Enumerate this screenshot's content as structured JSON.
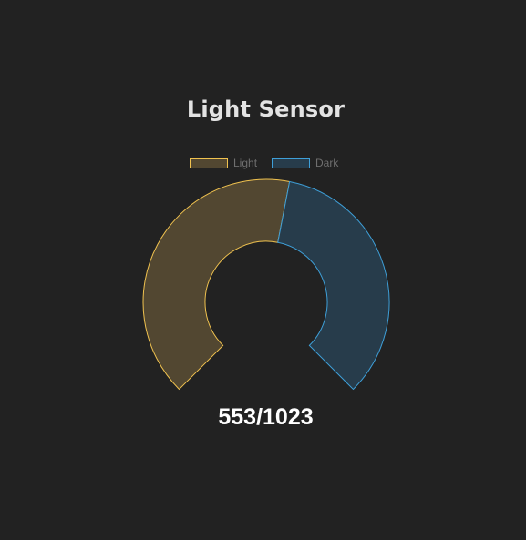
{
  "chart_data": {
    "type": "doughnut-gauge",
    "title": "Light Sensor",
    "series": [
      {
        "name": "Light",
        "value": 553,
        "fill": "#524731",
        "stroke": "#f0c24f"
      },
      {
        "name": "Dark",
        "value": 470,
        "fill": "#273c4b",
        "stroke": "#3e9fd8"
      }
    ],
    "max": 1023,
    "reading": "553/1023",
    "legend_position": "top"
  }
}
